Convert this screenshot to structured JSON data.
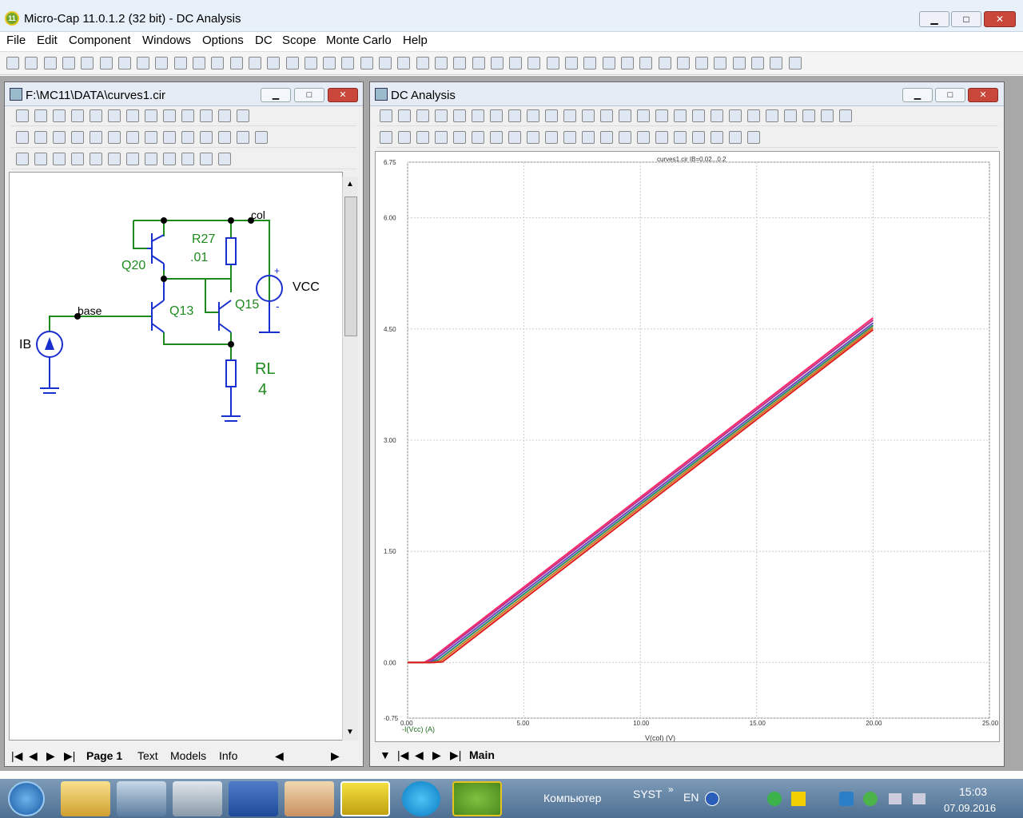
{
  "window": {
    "title": "Micro-Cap 11.0.1.2 (32 bit) - DC Analysis",
    "min": "▁",
    "max": "□",
    "close": "✕"
  },
  "menu": [
    "File",
    "Edit",
    "Component",
    "Windows",
    "Options",
    "DC",
    "Scope",
    "Monte Carlo",
    "Help"
  ],
  "schematic": {
    "title": "F:\\MC11\\DATA\\curves1.cir",
    "labels": {
      "q20": "Q20",
      "r27": "R27",
      "r27v": ".01",
      "col": "col",
      "vcc": "VCC",
      "base": "base",
      "q13": "Q13",
      "q15": "Q15",
      "ib": "IB",
      "rl": "RL",
      "rlv": "4",
      "plus": "+",
      "minus": "-"
    },
    "tabs": [
      "Page 1",
      "Text",
      "Models",
      "Info"
    ]
  },
  "analysis": {
    "title": "DC Analysis",
    "plot_title": "curves1.cir IB=0.02...0.2",
    "x_axis_label": "V(col) (V)",
    "y_axis_label": "-I(Vcc) (A)",
    "tab": "Main"
  },
  "chart_data": {
    "type": "line",
    "title": "curves1.cir IB=0.02...0.2",
    "xlabel": "V(col) (V)",
    "ylabel": "-I(Vcc) (A)",
    "xlim": [
      0,
      25
    ],
    "ylim": [
      -0.75,
      6.75
    ],
    "x_ticks": [
      "0.00",
      "5.00",
      "10.00",
      "15.00",
      "20.00",
      "25.00"
    ],
    "y_ticks": [
      "6.75",
      "6.00",
      "4.50",
      "3.00",
      "1.50",
      "0.00",
      "-0.75"
    ],
    "grid": true,
    "series": [
      {
        "color": "#ff2a6a",
        "x": [
          0,
          0.7,
          1.0,
          20
        ],
        "values": [
          0,
          0,
          0.05,
          4.65
        ]
      },
      {
        "color": "#b8328c",
        "x": [
          0,
          0.8,
          1.1,
          20
        ],
        "values": [
          0,
          0,
          0.05,
          4.62
        ]
      },
      {
        "color": "#6a4ac0",
        "x": [
          0,
          0.9,
          1.2,
          20
        ],
        "values": [
          0,
          0,
          0.04,
          4.58
        ]
      },
      {
        "color": "#2c8c66",
        "x": [
          0,
          1.0,
          1.3,
          20
        ],
        "values": [
          0,
          0,
          0.03,
          4.55
        ]
      },
      {
        "color": "#c87a1a",
        "x": [
          0,
          1.1,
          1.4,
          20
        ],
        "values": [
          0,
          0,
          0.02,
          4.52
        ]
      },
      {
        "color": "#e02020",
        "x": [
          0,
          1.1,
          1.5,
          20
        ],
        "values": [
          0,
          0,
          0.01,
          4.49
        ]
      }
    ]
  },
  "taskbar": {
    "computer": "Компьютер",
    "syst": "SYST",
    "lang": "EN",
    "time": "15:03",
    "date": "07.09.2016",
    "more": "»"
  },
  "colors": {
    "wire": "#1e8a1e",
    "component": "#1a2fd0",
    "label": "#1e8a1e",
    "node": "#000000"
  }
}
